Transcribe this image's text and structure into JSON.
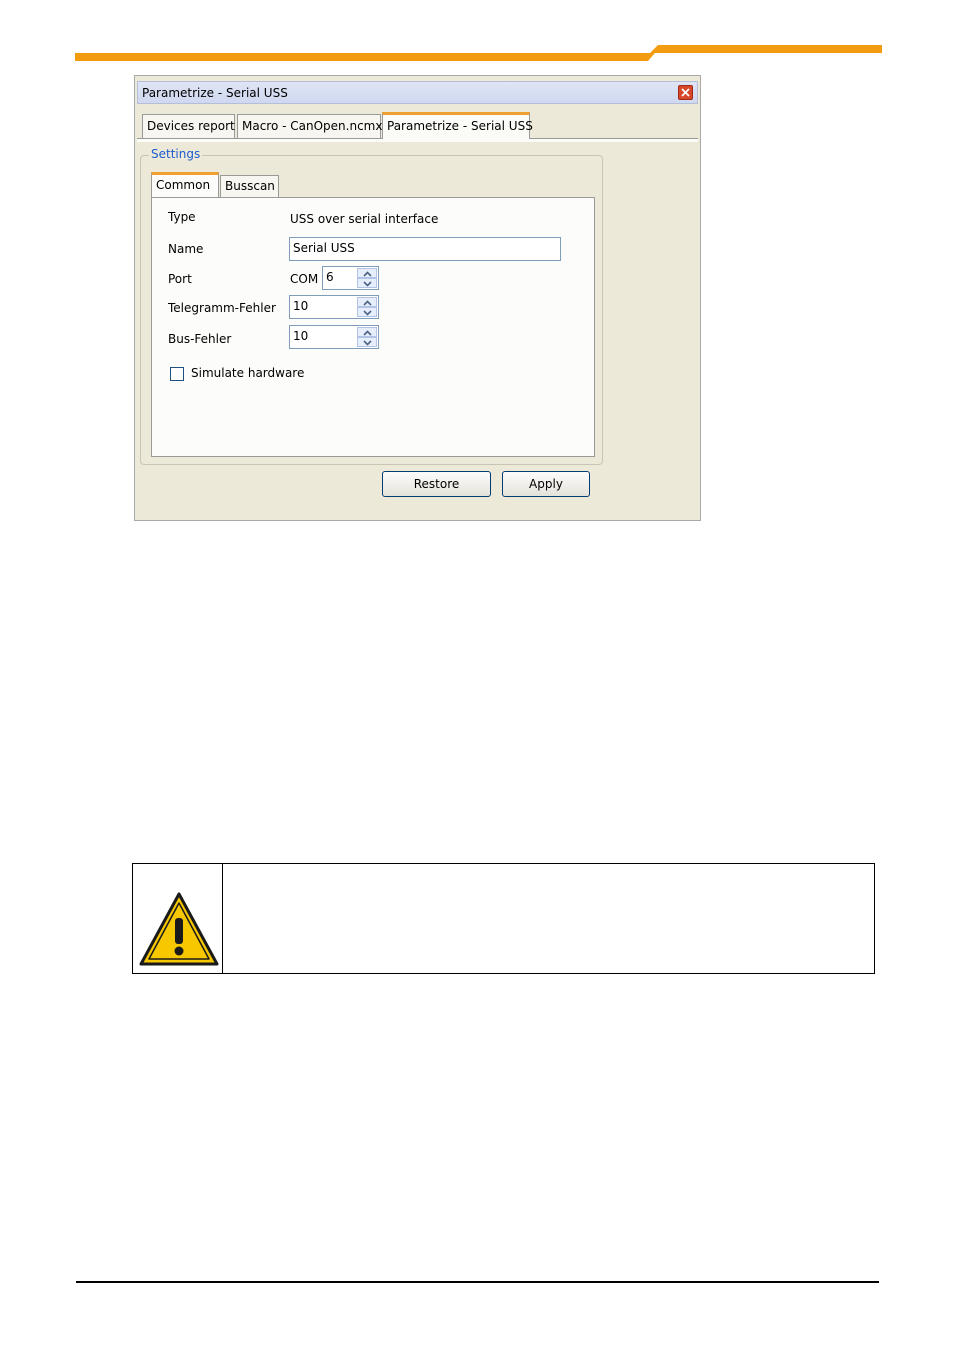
{
  "dialog": {
    "title": "Parametrize - Serial USS",
    "tabs": [
      "Devices report",
      "Macro - CanOpen.ncmx",
      "Parametrize - Serial USS"
    ],
    "group_label": "Settings",
    "inner_tabs": [
      "Common",
      "Busscan"
    ],
    "fields": {
      "type_label": "Type",
      "type_value": "USS over serial interface",
      "name_label": "Name",
      "name_value": "Serial USS",
      "port_label": "Port",
      "port_prefix": "COM",
      "port_value": "6",
      "telegramm_label": "Telegramm-Fehler",
      "telegramm_value": "10",
      "bus_label": "Bus-Fehler",
      "bus_value": "10"
    },
    "simulate_label": "Simulate hardware",
    "restore_label": "Restore",
    "apply_label": "Apply"
  },
  "colors": {
    "header_orange": "#f39c12",
    "active_tab_accent": "#f0a030",
    "group_label_blue": "#1c5ccf"
  },
  "icons": {
    "close": "close-icon",
    "warning": "warning-triangle-icon"
  }
}
